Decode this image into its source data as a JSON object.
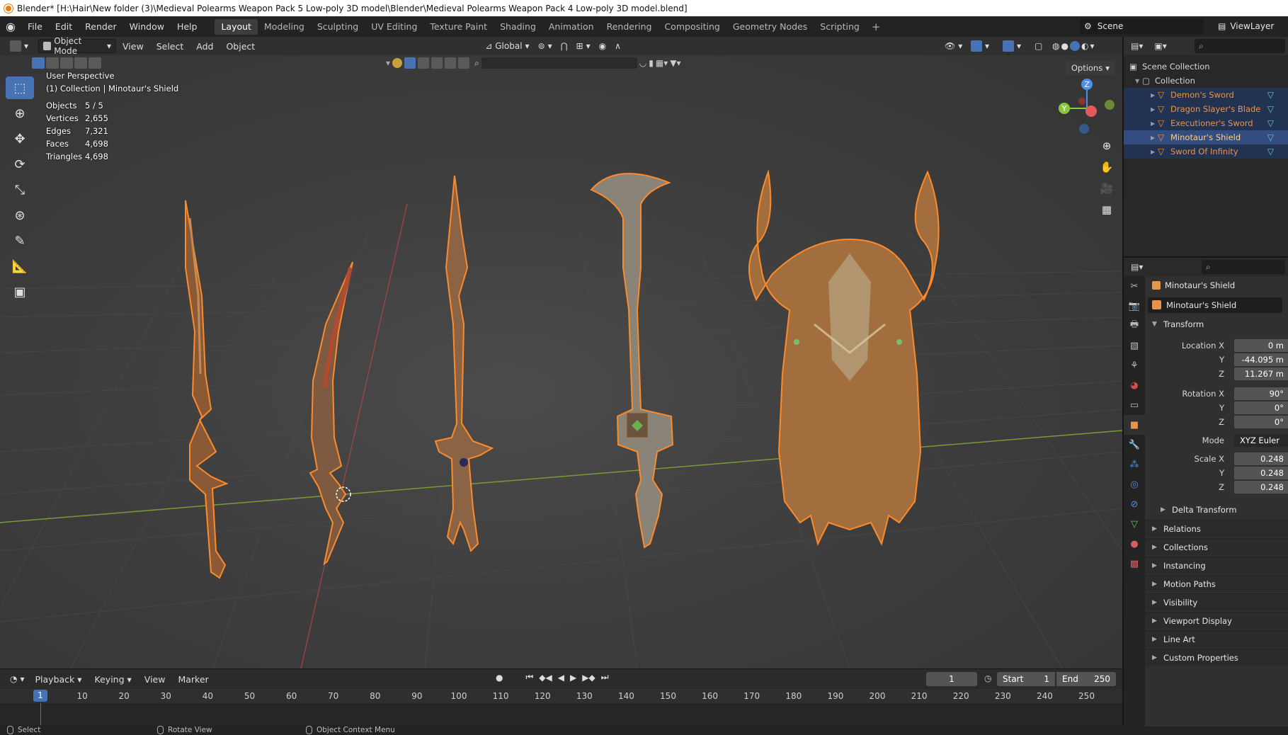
{
  "window": {
    "title": "Blender* [H:\\Hair\\New folder (3)\\Medieval Polearms Weapon Pack 5 Low-poly 3D model\\Blender\\Medieval Polearms Weapon Pack 4 Low-poly 3D model.blend]"
  },
  "topbar": {
    "menus": [
      "File",
      "Edit",
      "Render",
      "Window",
      "Help"
    ],
    "workspaces": [
      "Layout",
      "Modeling",
      "Sculpting",
      "UV Editing",
      "Texture Paint",
      "Shading",
      "Animation",
      "Rendering",
      "Compositing",
      "Geometry Nodes",
      "Scripting"
    ],
    "add_tab": "+",
    "scene": "Scene",
    "view_layer": "ViewLayer"
  },
  "viewport_header": {
    "mode": "Object Mode",
    "menus": [
      "View",
      "Select",
      "Add",
      "Object"
    ],
    "transform_orientation": "Global",
    "options": "Options"
  },
  "viewport": {
    "perspective": "User Perspective",
    "context": "(1) Collection | Minotaur's Shield",
    "stats": [
      {
        "label": "Objects",
        "value": "5 / 5"
      },
      {
        "label": "Vertices",
        "value": "2,655"
      },
      {
        "label": "Edges",
        "value": "7,321"
      },
      {
        "label": "Faces",
        "value": "4,698"
      },
      {
        "label": "Triangles",
        "value": "4,698"
      }
    ],
    "gizmo_axes": {
      "z": "Z",
      "y": "Y"
    }
  },
  "timeline": {
    "menus": [
      "Playback",
      "Keying",
      "View",
      "Marker"
    ],
    "current_frame": "1",
    "start_label": "Start",
    "start_value": "1",
    "end_label": "End",
    "end_value": "250",
    "ruler": [
      "10",
      "20",
      "30",
      "40",
      "50",
      "60",
      "70",
      "80",
      "90",
      "100",
      "110",
      "120",
      "130",
      "140",
      "150",
      "160",
      "170",
      "180",
      "190",
      "200",
      "210",
      "220",
      "230",
      "240",
      "250"
    ],
    "playhead": "1"
  },
  "statusbar": {
    "select": "Select",
    "rotate": "Rotate View",
    "context_menu": "Object Context Menu"
  },
  "outliner": {
    "scene_collection": "Scene Collection",
    "collection": "Collection",
    "objects": [
      "Demon's Sword",
      "Dragon Slayer's Blade",
      "Executioner's Sword",
      "Minotaur's Shield",
      "Sword Of Infinity"
    ],
    "active_index": 3
  },
  "properties": {
    "context_object": "Minotaur's Shield",
    "object_name": "Minotaur's Shield",
    "transform": {
      "title": "Transform",
      "location_label": "Location X",
      "location": [
        "0 m",
        "-44.095 m",
        "11.267 m"
      ],
      "rotation_label": "Rotation X",
      "rotation": [
        "90°",
        "0°",
        "0°"
      ],
      "mode_label": "Mode",
      "mode": "XYZ Euler",
      "scale_label": "Scale X",
      "scale": [
        "0.248",
        "0.248",
        "0.248"
      ],
      "y_label": "Y",
      "z_label": "Z"
    },
    "delta_transform": "Delta Transform",
    "panels": [
      "Relations",
      "Collections",
      "Instancing",
      "Motion Paths",
      "Visibility",
      "Viewport Display",
      "Line Art",
      "Custom Properties"
    ]
  },
  "colors": {
    "accent": "#4772b3",
    "selection_outline": "#e8944a",
    "x_axis": "#e35a5a",
    "y_axis": "#8cc63f",
    "z_axis": "#4f8fe8"
  }
}
